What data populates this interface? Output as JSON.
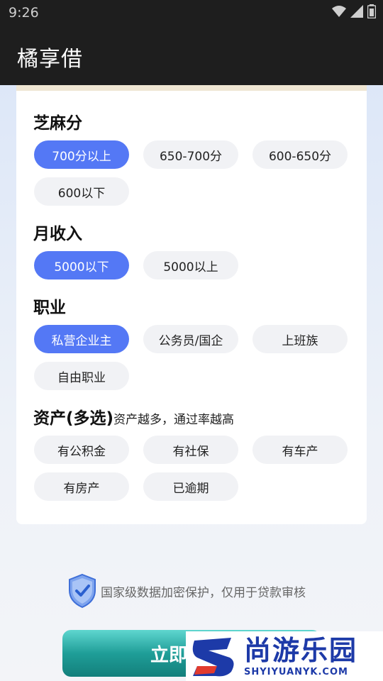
{
  "status_bar": {
    "time": "9:26"
  },
  "app_bar": {
    "title": "橘享借"
  },
  "sections": {
    "credit": {
      "title": "芝麻分",
      "options": [
        "700分以上",
        "650-700分",
        "600-650分",
        "600以下"
      ],
      "selected": "700分以上"
    },
    "income": {
      "title": "月收入",
      "options": [
        "5000以下",
        "5000以上"
      ],
      "selected": "5000以下"
    },
    "job": {
      "title": "职业",
      "options": [
        "私营企业主",
        "公务员/国企",
        "上班族",
        "自由职业"
      ],
      "selected": "私营企业主"
    },
    "assets": {
      "title": "资产(多选)",
      "subtitle": "资产越多，通过率越高",
      "options": [
        "有公积金",
        "有社保",
        "有车产",
        "有房产",
        "已逾期"
      ]
    }
  },
  "security": {
    "text": "国家级数据加密保护，仅用于贷款审核"
  },
  "cta": {
    "label": "立即"
  },
  "watermark": {
    "brand": "尚游乐园",
    "url": "SHYIYUANYK.COM"
  },
  "colors": {
    "selected_chip": "#5478f5",
    "chip": "#f1f2f5",
    "cta": "#1f9e98",
    "bar": "#1e1e1e"
  },
  "icons": [
    "wifi-icon",
    "signal-icon",
    "battery-icon",
    "shield-check-icon"
  ]
}
